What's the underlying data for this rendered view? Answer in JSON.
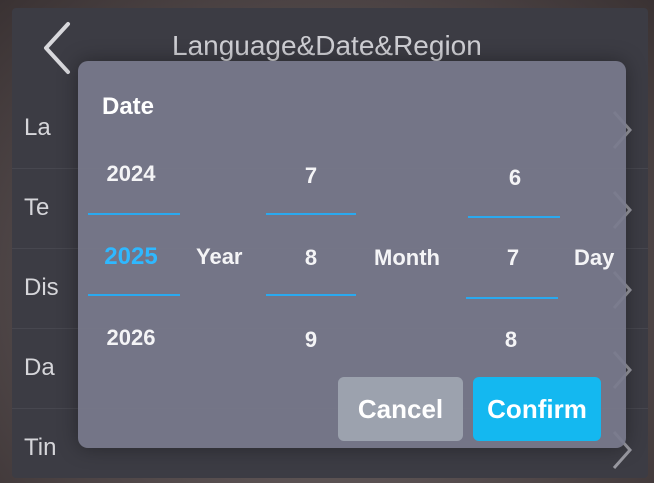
{
  "page": {
    "title": "Language&Date&Region",
    "rows": [
      {
        "label": "La"
      },
      {
        "label": "Te"
      },
      {
        "label": "Dis"
      },
      {
        "label": "Da"
      },
      {
        "label": "Tin"
      }
    ]
  },
  "dialog": {
    "title": "Date",
    "year": {
      "prev": "2024",
      "selected": "2025",
      "next": "2026",
      "unit": "Year"
    },
    "month": {
      "prev": "7",
      "selected": "8",
      "next": "9",
      "unit": "Month"
    },
    "day": {
      "prev": "6",
      "selected": "7",
      "next": "8",
      "unit": "Day"
    },
    "cancel_label": "Cancel",
    "confirm_label": "Confirm"
  },
  "colors": {
    "accent": "#14b8f0",
    "selected_text": "#2fb8ff"
  },
  "icons": {
    "back": "chevron-left-icon",
    "row": "chevron-right-icon"
  }
}
